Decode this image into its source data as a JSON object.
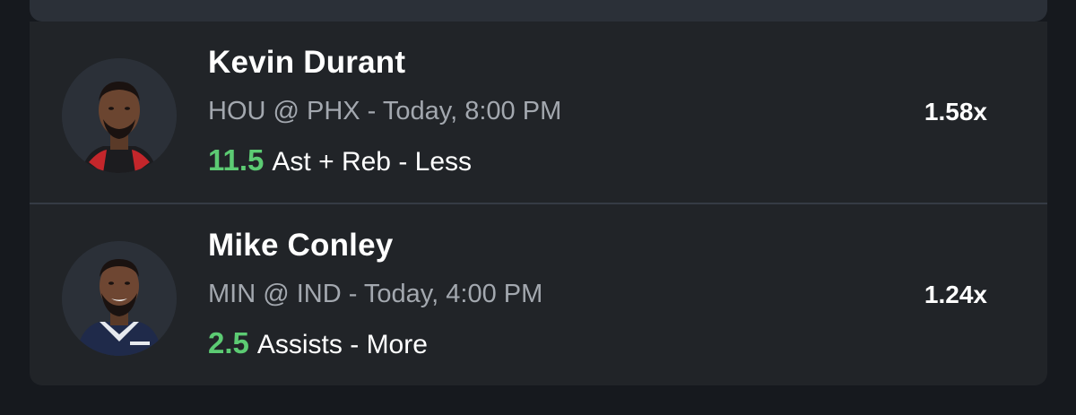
{
  "picks": [
    {
      "player": "Kevin Durant",
      "matchup": "HOU @ PHX",
      "time": "Today, 8:00 PM",
      "line": "11.5",
      "stat": "Ast + Reb",
      "direction": "Less",
      "multiplier": "1.58x"
    },
    {
      "player": "Mike Conley",
      "matchup": "MIN @ IND",
      "time": "Today, 4:00 PM",
      "line": "2.5",
      "stat": "Assists",
      "direction": "More",
      "multiplier": "1.24x"
    }
  ],
  "separator": " - ",
  "colors": {
    "background": "#16191e",
    "card": "#212428",
    "line_value": "#5ccb73",
    "muted_text": "#a3a8af"
  }
}
